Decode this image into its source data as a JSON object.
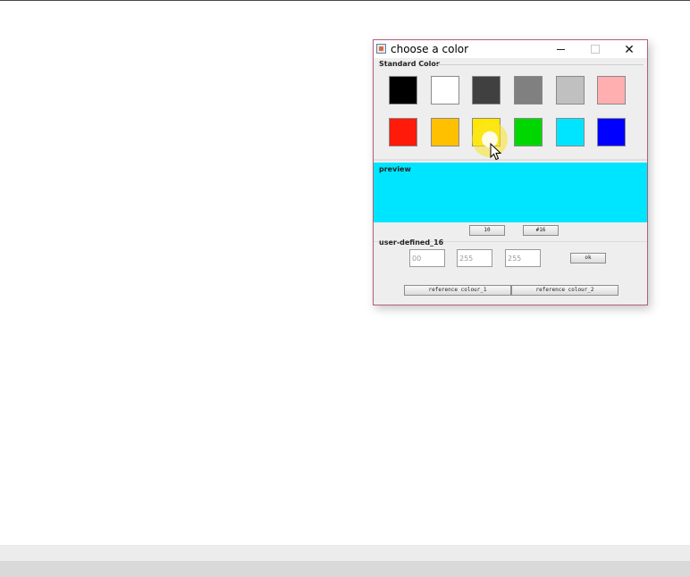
{
  "dialog": {
    "title": "choose a color",
    "icon": "java-app-icon",
    "window_controls": {
      "minimize": "minimize-icon",
      "maximize": "maximize-icon",
      "close": "✕"
    }
  },
  "standard_color": {
    "label": "Standard Color",
    "swatches": [
      {
        "name": "black",
        "color": "#000000"
      },
      {
        "name": "white",
        "color": "#ffffff"
      },
      {
        "name": "dark-gray",
        "color": "#404040"
      },
      {
        "name": "gray",
        "color": "#808080"
      },
      {
        "name": "light-gray",
        "color": "#c0c0c0"
      },
      {
        "name": "pink",
        "color": "#ffafaf"
      },
      {
        "name": "red",
        "color": "#ff1a0a"
      },
      {
        "name": "orange",
        "color": "#ffc000"
      },
      {
        "name": "yellow",
        "color": "#ffe600"
      },
      {
        "name": "green",
        "color": "#00d700"
      },
      {
        "name": "cyan",
        "color": "#00e5ff"
      },
      {
        "name": "blue",
        "color": "#0000ff"
      }
    ]
  },
  "preview": {
    "label": "preview",
    "color": "#00e5ff"
  },
  "format_buttons": {
    "decimal": "10",
    "hex": "#16"
  },
  "user_defined": {
    "label": "user-defined_16",
    "fields": [
      "00",
      "255",
      "255"
    ],
    "ok_label": "ok"
  },
  "reference": {
    "button_1": "reference colour_1",
    "button_2": "reference colour_2"
  }
}
